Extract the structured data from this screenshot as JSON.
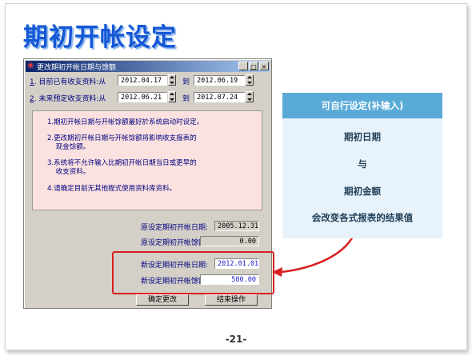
{
  "slide_title": "期初开帐设定",
  "page_number": "-21-",
  "window": {
    "title": "更改期初开帐日期与馀额",
    "controls": {
      "minimize": "_",
      "maximize": "□",
      "close": "×"
    },
    "row1": {
      "label": "目前已有收支资料:从",
      "accel": "1",
      "from": "2012.04.17",
      "to_label": "到",
      "to": "2012.06.19"
    },
    "row2": {
      "label": "未来预定收支资料:从",
      "accel": "2",
      "from": "2012.06.21",
      "to_label": "到",
      "to": "2012.07.24"
    },
    "notes": [
      "1.期初开帐日期与开帐馀额最好於系统启动时设定。",
      "2.更改期初开帐日期与开帐馀额将影响收支报表的\n    现金馀额。",
      "3.系统将不允许输入比期初开帐日期当日或更早的\n    收支资料。",
      "4.请确定目前无其他程式使用资料库资料。"
    ],
    "orig_date_label": "原设定期初开帐日期:",
    "orig_date_value": "2005.12.31",
    "orig_bal_label": "原设定期初开帐馀额:",
    "orig_bal_value": "0.00",
    "new_date_label": "新设定期初开帐日期:",
    "new_date_value": "2012.01.01",
    "new_bal_label": "新设定期初开帐馀额:",
    "new_bal_value": "500.00",
    "confirm_button": "确定更改",
    "finish_button": "结束操作"
  },
  "side_panel": {
    "heading": "可自行设定(补输入)",
    "line1": "期初日期",
    "line2": "与",
    "line3": "期初金额",
    "line4": "会改变各式报表的结果值"
  },
  "colors": {
    "title": "#1457d6",
    "panel_head": "#5aaad8",
    "panel_body": "#e7f2fa",
    "highlight": "#d82020",
    "info_bg": "#fbe2e0"
  }
}
